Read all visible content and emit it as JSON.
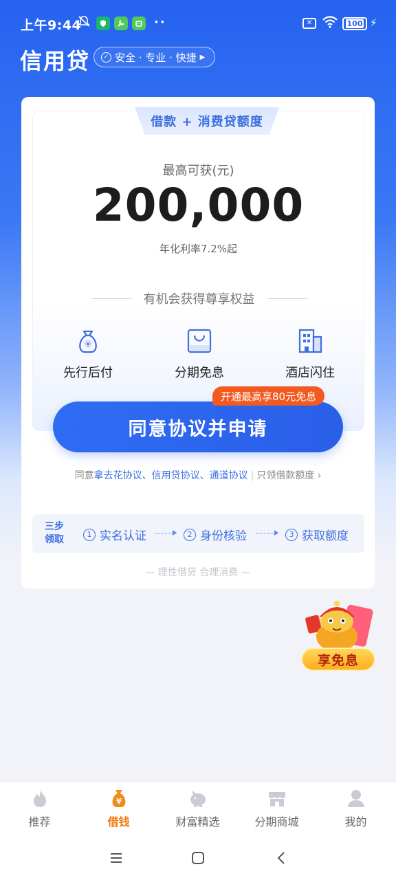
{
  "status_bar": {
    "time": "上午9:44",
    "battery": "100"
  },
  "header": {
    "title": "信用贷",
    "safety_tagline": "安全 · 专业 · 快捷"
  },
  "card": {
    "tab_label": "借款 + 消费贷额度",
    "max_label": "最高可获(元)",
    "amount": "200,000",
    "rate": "年化利率7.2%起",
    "benefit_heading": "有机会获得尊享权益",
    "features": [
      {
        "label": "先行后付",
        "icon": "money-bag-icon"
      },
      {
        "label": "分期免息",
        "icon": "shopping-bag-icon"
      },
      {
        "label": "酒店闪住",
        "icon": "hotel-icon"
      }
    ],
    "promo_badge": "开通最高享80元免息",
    "cta_label": "同意协议并申请",
    "agree_prefix": "同意",
    "agree_links": "拿去花协议、信用贷协议、通道协议",
    "agree_secondary": "只领借款额度",
    "steps_title_line1": "三步",
    "steps_title_line2": "领取",
    "steps": [
      {
        "num": "1",
        "label": "实名认证"
      },
      {
        "num": "2",
        "label": "身份核验"
      },
      {
        "num": "3",
        "label": "获取额度"
      }
    ],
    "slogan": "— 理性借贷 合理消费 —"
  },
  "float_promo": {
    "label": "享免息"
  },
  "bottom_nav": [
    {
      "label": "推荐",
      "icon": "flame-icon"
    },
    {
      "label": "借钱",
      "icon": "money-bag-icon"
    },
    {
      "label": "财富精选",
      "icon": "piggy-bank-icon"
    },
    {
      "label": "分期商城",
      "icon": "store-icon"
    },
    {
      "label": "我的",
      "icon": "person-icon"
    }
  ],
  "colors": {
    "primary": "#2f6cf4",
    "accent": "#ef7d12",
    "promo": "#f25a1f"
  }
}
